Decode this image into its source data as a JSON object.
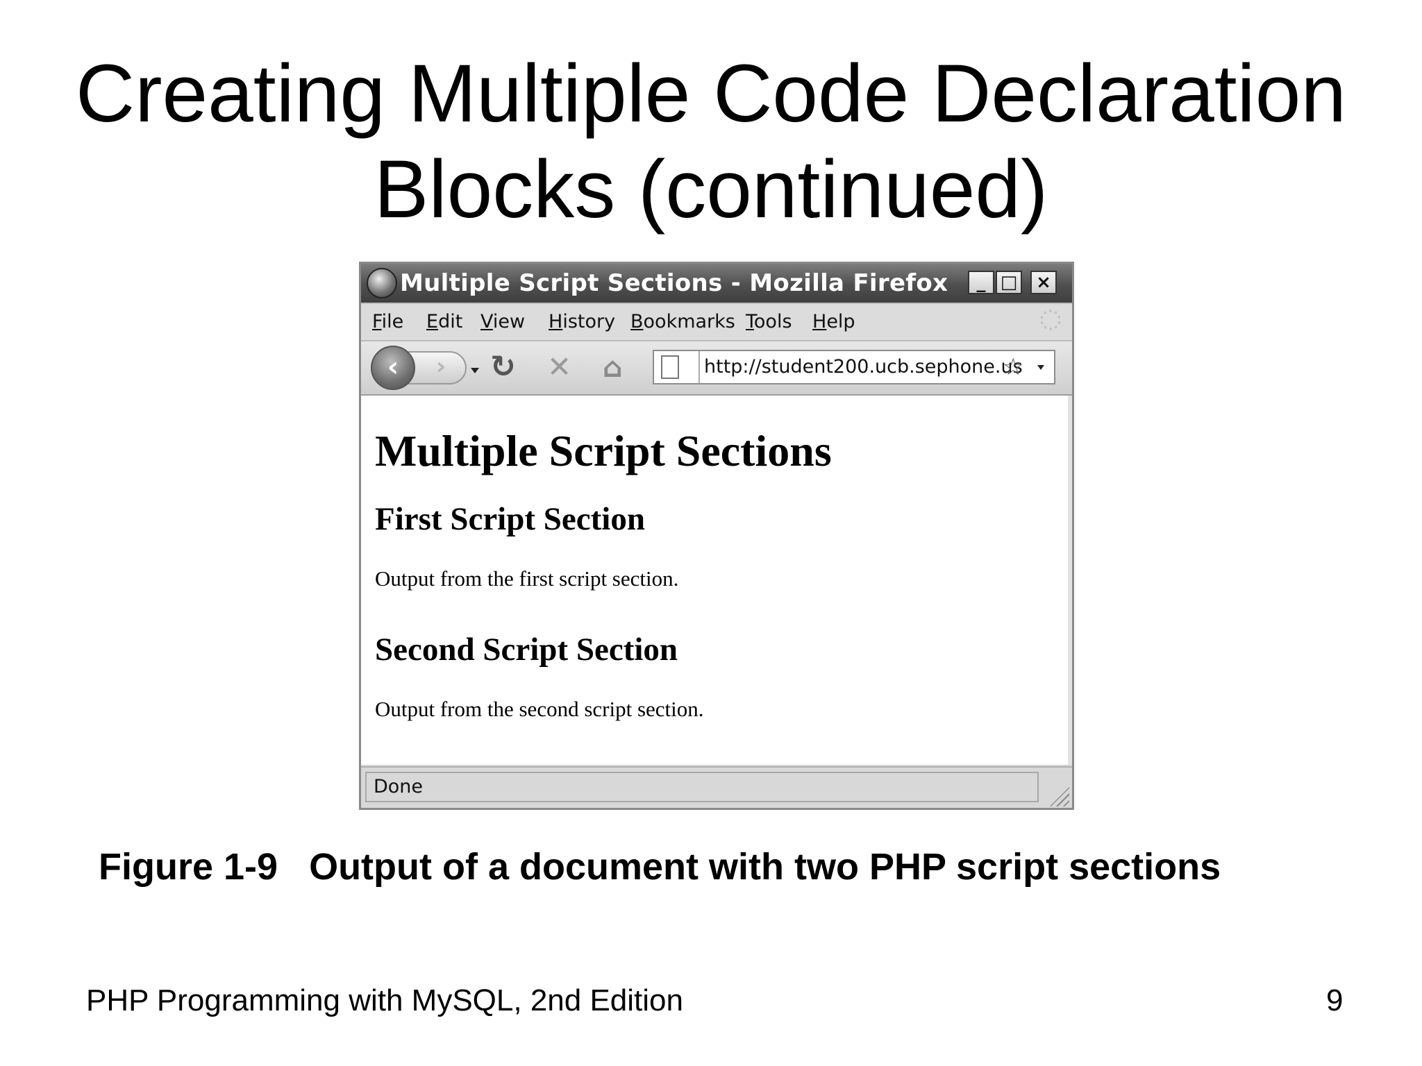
{
  "slide": {
    "title_line1": "Creating Multiple Code Declaration",
    "title_line2": "Blocks (continued)",
    "caption": "Figure 1-9   Output of a document with two PHP script sections",
    "footer_left": "PHP Programming with MySQL, 2nd Edition",
    "page_number": "9"
  },
  "browser": {
    "window_title": "Multiple Script Sections - Mozilla Firefox",
    "window_controls": {
      "minimize": "_",
      "maximize": "□",
      "close": "×"
    },
    "menu": [
      "File",
      "Edit",
      "View",
      "History",
      "Bookmarks",
      "Tools",
      "Help"
    ],
    "nav": {
      "back_icon": "‹",
      "forward_icon": "›",
      "reload_icon": "↻",
      "stop_icon": "✕",
      "home_icon": "⌂",
      "bookmark_star_icon": "☆",
      "url": "http://student200.ucb.sephone.us"
    },
    "page": {
      "h1": "Multiple Script Sections",
      "section1_heading": "First Script Section",
      "section1_output": "Output from the first script section.",
      "section2_heading": "Second Script Section",
      "section2_output": "Output from the second script section."
    },
    "status": "Done"
  },
  "colors": {
    "titlebar": "#4f4f4f",
    "chrome": "#d6d6d6",
    "page_background": "#ffffff"
  }
}
